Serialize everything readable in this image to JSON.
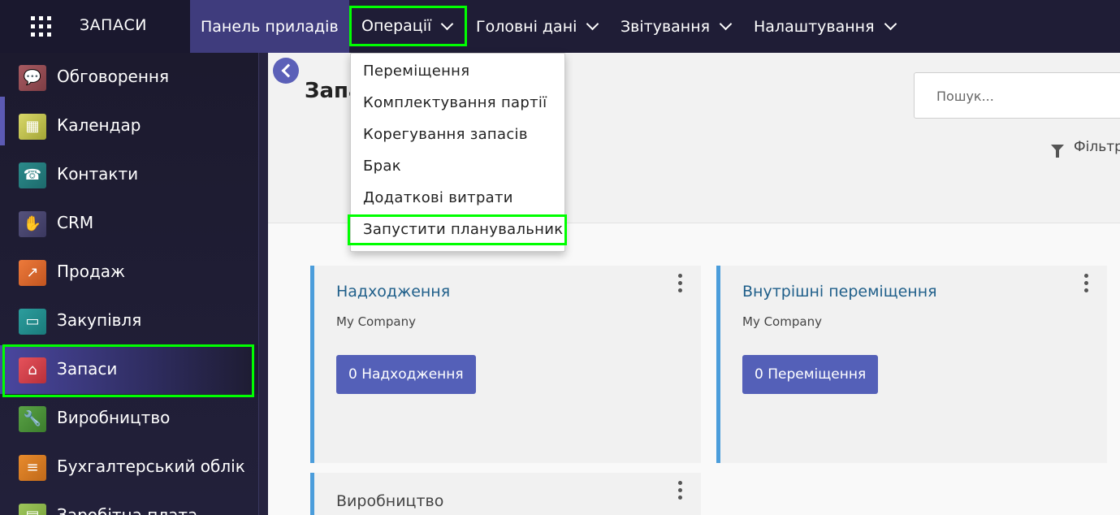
{
  "navbar": {
    "app_title": "ЗАПАСИ",
    "menu": {
      "dashboard": "Панель приладів",
      "operations": "Операції",
      "master_data": "Головні дані",
      "reporting": "Звітування",
      "settings": "Налаштування"
    }
  },
  "operations_menu": [
    "Переміщення",
    "Комплектування партії",
    "Корегування запасів",
    "Брак",
    "Додаткові витрати",
    "Запустити планувальник"
  ],
  "sidebar": {
    "items": [
      {
        "label": "Обговорення",
        "icon": "chat-icon"
      },
      {
        "label": "Календар",
        "icon": "calendar-icon"
      },
      {
        "label": "Контакти",
        "icon": "contacts-icon"
      },
      {
        "label": "CRM",
        "icon": "handshake-icon"
      },
      {
        "label": "Продаж",
        "icon": "sales-chart-icon"
      },
      {
        "label": "Закупівля",
        "icon": "credit-card-icon"
      },
      {
        "label": "Запаси",
        "icon": "warehouse-icon"
      },
      {
        "label": "Виробництво",
        "icon": "wrench-icon"
      },
      {
        "label": "Бухгалтерський облік",
        "icon": "document-icon"
      },
      {
        "label": "Заробітна плата",
        "icon": "payroll-icon"
      }
    ],
    "active": "Запаси"
  },
  "control_panel": {
    "title": "Запаси",
    "search_placeholder": "Пошук...",
    "filters_label": "Фільтри"
  },
  "cards": [
    {
      "title": "Надходження",
      "company": "My Company",
      "button": "0 Надходження"
    },
    {
      "title": "Внутрішні переміщення",
      "company": "My Company",
      "button": "0 Переміщення"
    },
    {
      "title": "Виробництво"
    }
  ],
  "colors": {
    "navbar": "#1f1d36",
    "accent": "#5460b8",
    "highlight": "#00ff00",
    "card_border": "#4b9ddb"
  }
}
